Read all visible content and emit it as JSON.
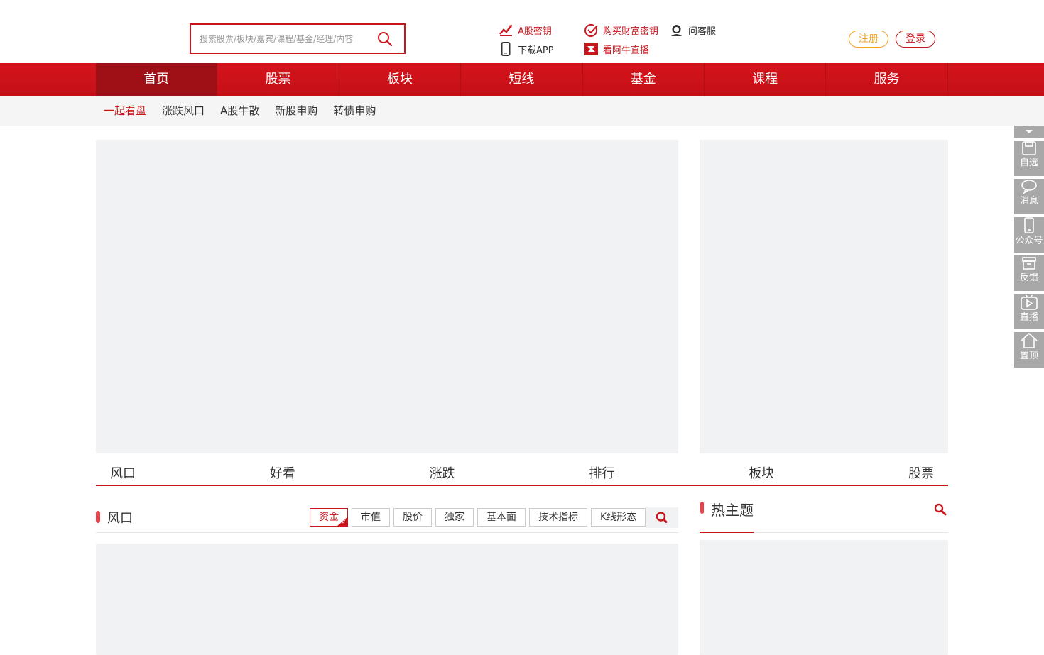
{
  "search": {
    "placeholder": "搜索股票/板块/嘉宾/课程/基金/经理/内容"
  },
  "quick_links": {
    "a_key": "A股密钥",
    "buy_key": "购买财富密钥",
    "service": "问客服",
    "download": "下载APP",
    "live": "看阿牛直播"
  },
  "auth": {
    "register": "注册",
    "login": "登录"
  },
  "main_nav": [
    "首页",
    "股票",
    "板块",
    "短线",
    "基金",
    "课程",
    "服务"
  ],
  "sub_nav": [
    "一起看盘",
    "涨跌风口",
    "A股牛散",
    "新股申购",
    "转债申购"
  ],
  "tabs": [
    "风口",
    "好看",
    "涨跌",
    "排行",
    "板块",
    "股票"
  ],
  "section": {
    "title": "风口",
    "filters": [
      "资金",
      "市值",
      "股价",
      "独家",
      "基本面",
      "技术指标",
      "K线形态"
    ]
  },
  "hot": {
    "title": "热主题"
  },
  "float_bar": [
    "自选",
    "消息",
    "公众号",
    "反馈",
    "直播",
    "置顶"
  ],
  "colors": {
    "brand_red": "#c8161d",
    "nav_active": "#9f1016",
    "accent_orange": "#f5a623",
    "panel_gray": "#f1f2f4"
  }
}
